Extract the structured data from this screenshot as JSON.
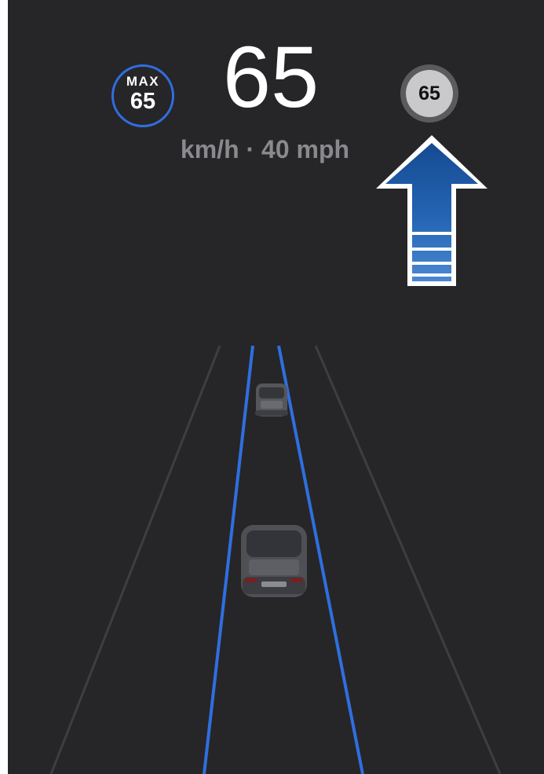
{
  "speed_display": {
    "max_label": "MAX",
    "max_value": "65",
    "current_speed": "65",
    "units_text": "km/h · 40 mph",
    "sign_value": "65"
  },
  "icons": {
    "lane_change_arrow": "up-arrow-icon",
    "lead_vehicle": "car-icon",
    "ego_vehicle": "car-icon"
  },
  "colors": {
    "background": "#262628",
    "lane_line_active": "#2f6fe0",
    "lane_line_inactive": "#3e3e42",
    "max_ring": "#2f6fe0",
    "arrow_blue": "#1f5fb2"
  }
}
